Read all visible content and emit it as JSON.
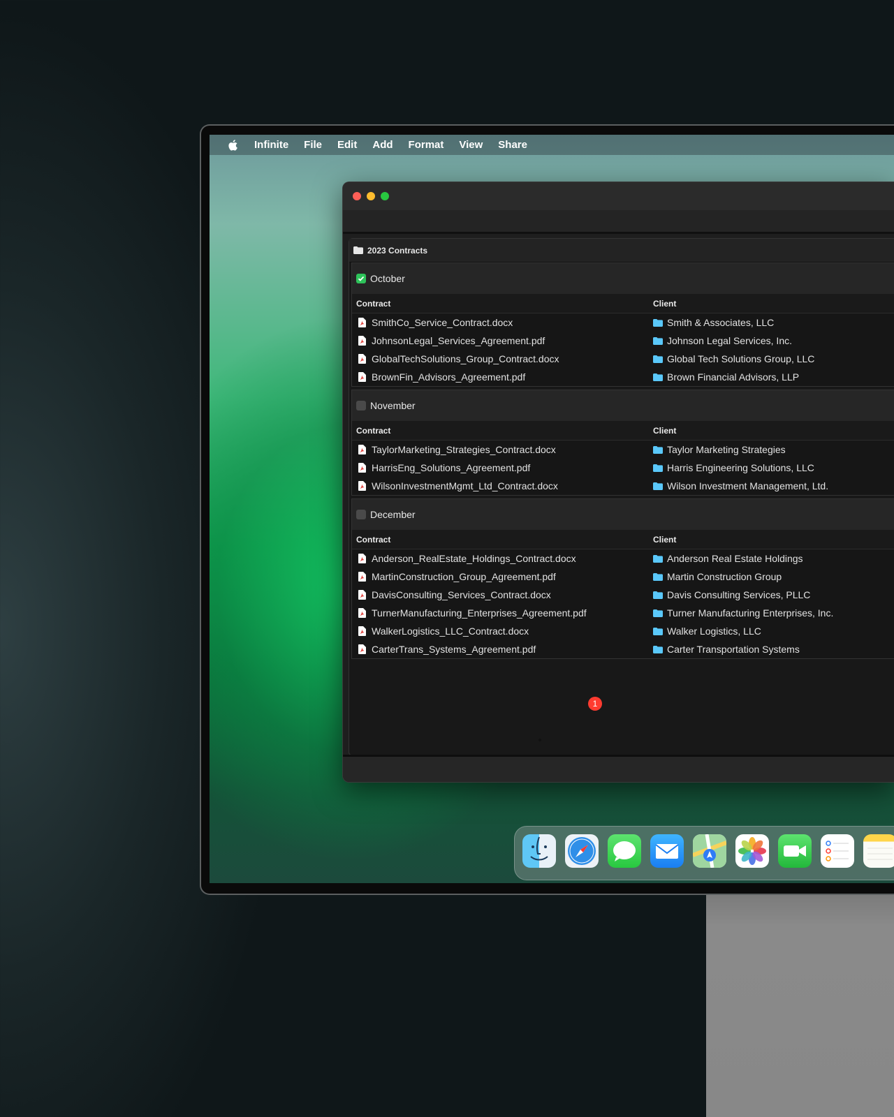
{
  "menubar": {
    "app": "Infinite",
    "items": [
      "File",
      "Edit",
      "Add",
      "Format",
      "View",
      "Share"
    ]
  },
  "folder": {
    "title": "2023 Contracts"
  },
  "columns": {
    "contract": "Contract",
    "client": "Client"
  },
  "groups": [
    {
      "name": "October",
      "checked": true,
      "rows": [
        {
          "contract": "SmithCo_Service_Contract.docx",
          "client": "Smith & Associates, LLC"
        },
        {
          "contract": "JohnsonLegal_Services_Agreement.pdf",
          "client": "Johnson Legal Services, Inc."
        },
        {
          "contract": "GlobalTechSolutions_Group_Contract.docx",
          "client": "Global Tech Solutions Group, LLC"
        },
        {
          "contract": "BrownFin_Advisors_Agreement.pdf",
          "client": "Brown Financial Advisors, LLP"
        }
      ]
    },
    {
      "name": "November",
      "checked": false,
      "rows": [
        {
          "contract": "TaylorMarketing_Strategies_Contract.docx",
          "client": "Taylor Marketing Strategies"
        },
        {
          "contract": "HarrisEng_Solutions_Agreement.pdf",
          "client": "Harris Engineering Solutions, LLC"
        },
        {
          "contract": "WilsonInvestmentMgmt_Ltd_Contract.docx",
          "client": "Wilson Investment Management, Ltd."
        }
      ]
    },
    {
      "name": "December",
      "checked": false,
      "rows": [
        {
          "contract": "Anderson_RealEstate_Holdings_Contract.docx",
          "client": "Anderson Real Estate Holdings"
        },
        {
          "contract": "MartinConstruction_Group_Agreement.pdf",
          "client": "Martin Construction Group"
        },
        {
          "contract": "DavisConsulting_Services_Contract.docx",
          "client": "Davis Consulting Services, PLLC"
        },
        {
          "contract": "TurnerManufacturing_Enterprises_Agreement.pdf",
          "client": "Turner Manufacturing Enterprises, Inc."
        },
        {
          "contract": "WalkerLogistics_LLC_Contract.docx",
          "client": "Walker Logistics, LLC"
        },
        {
          "contract": "CarterTrans_Systems_Agreement.pdf",
          "client": "Carter Transportation Systems"
        }
      ]
    }
  ],
  "dock": {
    "apps": [
      "finder-icon",
      "safari-icon",
      "messages-icon",
      "mail-icon",
      "maps-icon",
      "photos-icon",
      "facetime-icon",
      "reminders-icon",
      "notes-icon"
    ],
    "safari_badge": "1"
  },
  "colors": {
    "accent_green": "#2ec35a",
    "folder_blue": "#5ac8fa",
    "pdf_red": "#e0403a"
  }
}
